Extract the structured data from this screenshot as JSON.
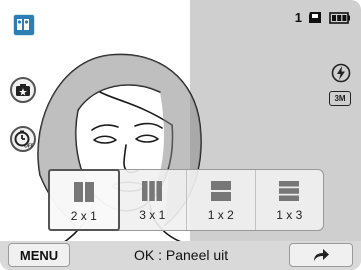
{
  "colors": {
    "accent": "#2d7fb3",
    "panel_bg": "#f0f0f0",
    "right_bg": "#cfcfcf"
  },
  "status": {
    "shot_count": "1",
    "icons": [
      "memory-card-icon",
      "battery-icon"
    ]
  },
  "left_controls": [
    "shooting-mode-icon",
    "smart-mode-icon",
    "timer-off-icon"
  ],
  "right_controls": [
    "flash-icon",
    "photo-size-3m-icon"
  ],
  "photo_size_label": "3M",
  "layout_options": [
    {
      "label": "2 x 1",
      "selected": true
    },
    {
      "label": "3 x 1",
      "selected": false
    },
    {
      "label": "1 x 2",
      "selected": false
    },
    {
      "label": "1 x 3",
      "selected": false
    }
  ],
  "bottom_bar": {
    "menu_label": "MENU",
    "hint_text": "OK : Paneel uit",
    "back_icon": "arrow-return-icon"
  }
}
